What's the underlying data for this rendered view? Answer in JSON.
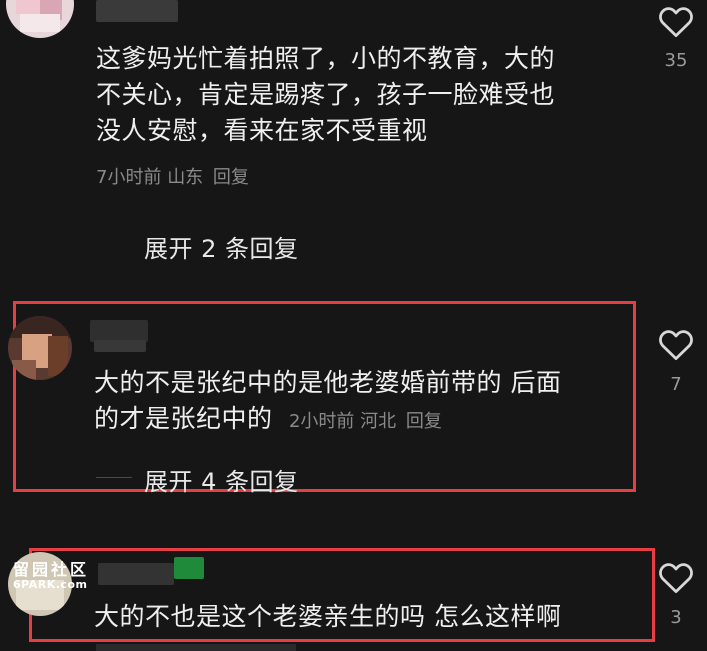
{
  "comments": [
    {
      "text_lines": [
        "这爹妈光忙着拍照了，小的不教育，大的",
        "不关心，肯定是踢疼了，孩子一脸难受也",
        "没人安慰，看来在家不受重视"
      ],
      "time": "7小时前",
      "location": "山东",
      "reply": "回复",
      "likes": "35",
      "expand": "展开 2 条回复"
    },
    {
      "text_lines": [
        "大的不是张纪中的是他老婆婚前带的 后面",
        "的才是张纪中的"
      ],
      "time": "2小时前",
      "location": "河北",
      "reply": "回复",
      "likes": "7",
      "expand": "展开 4 条回复"
    },
    {
      "text_lines": [
        "大的不也是这个老婆亲生的吗 怎么这样啊"
      ],
      "likes": "3"
    }
  ],
  "watermark": {
    "cn": "留园社区",
    "en": "6PARK.com"
  },
  "colors": {
    "background": "#161616",
    "highlight": "#e53f45",
    "text": "#efefef",
    "meta": "#8a8a8a"
  },
  "icons": {
    "like": "heart-outline-icon"
  }
}
